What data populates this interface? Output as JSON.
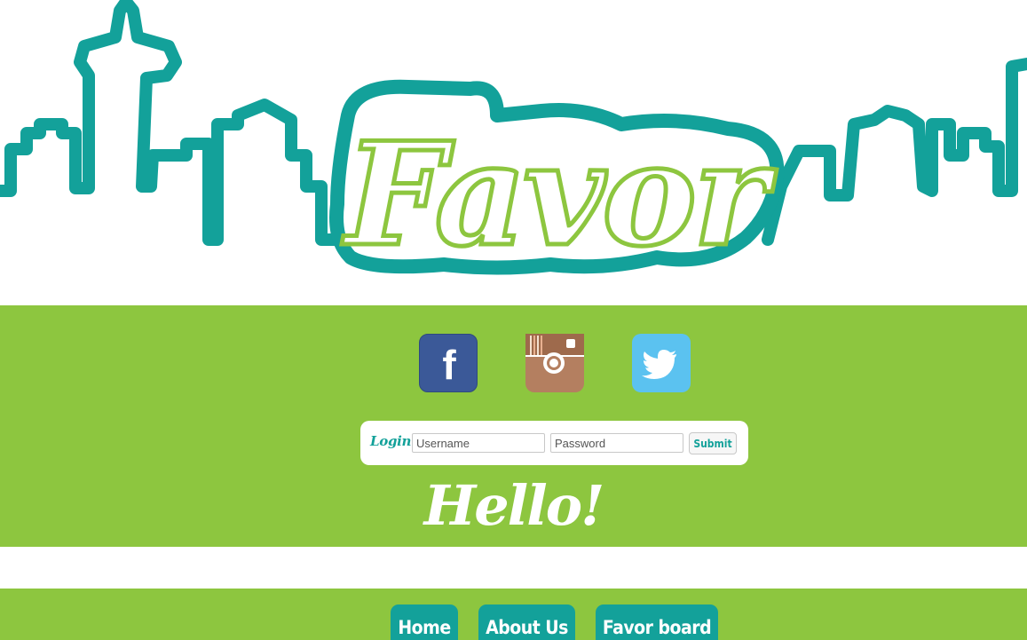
{
  "header": {
    "logo_text": "Favor"
  },
  "social": {
    "items": [
      {
        "name": "facebook",
        "icon": "facebook-icon",
        "glyph": "f"
      },
      {
        "name": "instagram",
        "icon": "instagram-icon"
      },
      {
        "name": "twitter",
        "icon": "twitter-icon"
      }
    ]
  },
  "login": {
    "label": "Login:",
    "username_placeholder": "Username",
    "password_placeholder": "Password",
    "submit_label": "Submit"
  },
  "greeting": "Hello!",
  "nav": {
    "items": [
      {
        "label": "Home"
      },
      {
        "label": "About Us"
      },
      {
        "label": "Favor board"
      }
    ]
  },
  "colors": {
    "teal": "#13a19a",
    "green": "#8dc63f",
    "white": "#ffffff",
    "facebook": "#3b5998",
    "instagram": "#b47f60",
    "twitter": "#5bc2f0"
  }
}
